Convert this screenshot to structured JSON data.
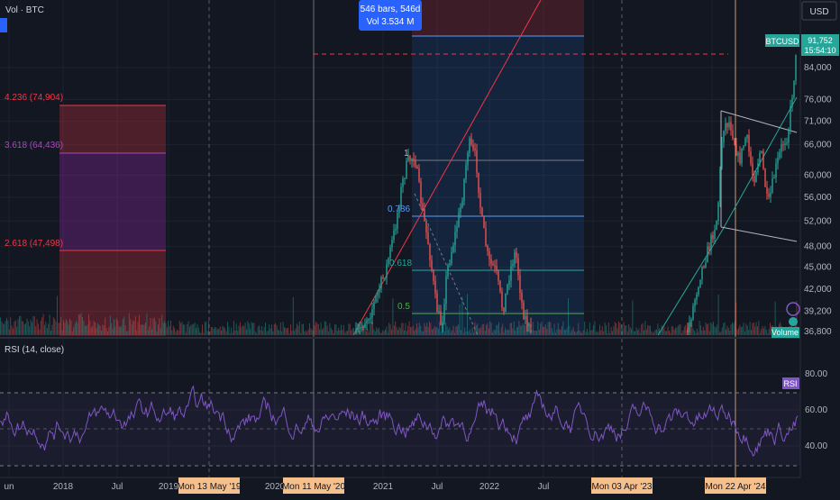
{
  "header": {
    "vol_label": "Vol · BTC",
    "currency": "USD",
    "measure": {
      "line1": "546 bars, 546d",
      "line2": "Vol 3.534 M"
    }
  },
  "price_badge": {
    "symbol": "BTCUSD",
    "price": "91,752",
    "countdown": "15:54:10"
  },
  "volume_badge": "Volume",
  "rsi_badge": "RSI",
  "rsi_title": "RSI (14, close)",
  "chart_data": [
    {
      "type": "candlestick",
      "series": [
        {
          "name": "BTCUSD"
        },
        {
          "name": "Volume"
        }
      ],
      "y_axis": {
        "ticks": [
          84000,
          76000,
          71000,
          66000,
          60000,
          56000,
          52000,
          48000,
          45000,
          42000,
          39200,
          36800
        ],
        "range": [
          36800,
          91752
        ],
        "scale": "log"
      },
      "x_axis": {
        "ticks": [
          "un",
          "2018",
          "Jul",
          "2019",
          "2020",
          "2021",
          "Jul",
          "2022",
          "Jul",
          "2",
          "202"
        ],
        "crosshair_dates": [
          "Mon 13 May '19",
          "Mon 11 May '20",
          "Mon 03 Apr '23",
          "Mon 22 Apr '24"
        ]
      },
      "fibonacci_extension": [
        {
          "label": "4.236 (74,904)",
          "value": 74904,
          "color": "#f23645"
        },
        {
          "label": "3.618 (64,436)",
          "value": 64436,
          "color": "#9c27b0"
        },
        {
          "label": "2.618 (47,498)",
          "value": 47498,
          "color": "#f23645"
        }
      ],
      "fibonacci_retracement": [
        {
          "label": "1",
          "value": 1
        },
        {
          "label": "0.786",
          "value": 0.786
        },
        {
          "label": "0.618",
          "value": 0.618
        },
        {
          "label": "0.5",
          "value": 0.5
        }
      ],
      "last_price": 91752,
      "grid": true
    },
    {
      "type": "line",
      "series": [
        {
          "name": "RSI (14, close)"
        }
      ],
      "y_axis": {
        "ticks": [
          80,
          60,
          40
        ],
        "range": [
          25,
          98
        ]
      },
      "bands": [
        70,
        30
      ],
      "grid": true
    }
  ],
  "colors": {
    "background": "#131722",
    "up": "#26a69a",
    "down": "#ef5350",
    "rsi": "#7e57c2",
    "accent": "#2962ff",
    "crosshair_label": "#f6c08c"
  }
}
